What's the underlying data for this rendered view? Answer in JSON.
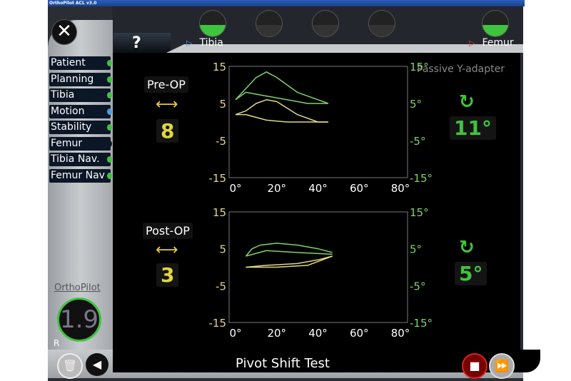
{
  "window": {
    "title": "OrthoPilot ACL v3.0"
  },
  "toolbar": {
    "help_label": "?",
    "segments": [
      {
        "label": "Tibia",
        "marker_color": "#4aa8e0"
      },
      {
        "label": "Femur",
        "marker_color": "#e04a3a"
      }
    ],
    "sensors": [
      {
        "name": "tibia",
        "visible": true
      },
      {
        "name": "s2",
        "visible": false
      },
      {
        "name": "s3",
        "visible": false
      },
      {
        "name": "s4",
        "visible": false
      },
      {
        "name": "femur",
        "visible": true
      }
    ]
  },
  "sidebar": {
    "items": [
      {
        "label": "Patient",
        "status_color": "#3ec33e"
      },
      {
        "label": "Planning",
        "status_color": "#3ec33e"
      },
      {
        "label": "Tibia",
        "status_color": "#3ec33e"
      },
      {
        "label": "Motion",
        "status_color": "#4a9de0"
      },
      {
        "label": "Stability",
        "status_color": "#3ec33e"
      },
      {
        "label": "Femur",
        "status_color": "#0b1626"
      },
      {
        "label": "Tibia Nav.",
        "status_color": "#3ec33e"
      },
      {
        "label": "Femur Nav",
        "status_color": "#3ec33e"
      }
    ],
    "brand": "OrthoPilot",
    "logo_text": "1.9",
    "side": "R"
  },
  "adapter_label": "Passive Y-adapter",
  "pre": {
    "label": "Pre-OP",
    "translation": "8",
    "rotation": "11°"
  },
  "post": {
    "label": "Post-OP",
    "translation": "3",
    "rotation": "5°"
  },
  "footer": {
    "title": "Pivot Shift Test"
  },
  "colors": {
    "translation": "#e2d640",
    "rotation": "#3fc43f",
    "axis_left": "#e2d68a",
    "axis_right": "#7fd36a"
  },
  "chart_data": [
    {
      "type": "line",
      "title": "Pre-OP",
      "xticks": [
        "0°",
        "20°",
        "40°",
        "60°",
        "80°"
      ],
      "yticks_left": [
        "15",
        "5",
        "-5",
        "-15"
      ],
      "yticks_right": [
        "15°",
        "5°",
        "-5°",
        "-15°"
      ],
      "xlim": [
        0,
        80
      ],
      "ylim": [
        -15,
        15
      ],
      "series": [
        {
          "color": "#7fd36a",
          "x": [
            0,
            5,
            10,
            15,
            20,
            30,
            40,
            45
          ],
          "y": [
            6,
            9,
            12,
            13.5,
            12,
            8,
            6,
            5
          ]
        },
        {
          "color": "#7fd36a",
          "x": [
            0,
            5,
            15,
            25,
            35,
            45
          ],
          "y": [
            6,
            8,
            7,
            6,
            5,
            5
          ]
        },
        {
          "color": "#e2d68a",
          "x": [
            0,
            5,
            10,
            15,
            20,
            30,
            40,
            45
          ],
          "y": [
            2,
            3,
            5,
            6,
            5.5,
            2,
            0,
            0
          ]
        },
        {
          "color": "#e2d68a",
          "x": [
            0,
            5,
            15,
            25,
            35,
            45
          ],
          "y": [
            2,
            2,
            0.5,
            0,
            0,
            0
          ]
        }
      ]
    },
    {
      "type": "line",
      "title": "Post-OP",
      "xticks": [
        "0°",
        "20°",
        "40°",
        "60°",
        "80°"
      ],
      "yticks_left": [
        "15",
        "5",
        "-5",
        "-15"
      ],
      "yticks_right": [
        "15°",
        "5°",
        "-5°",
        "-15°"
      ],
      "xlim": [
        0,
        80
      ],
      "ylim": [
        -15,
        15
      ],
      "series": [
        {
          "color": "#7fd36a",
          "x": [
            5,
            8,
            12,
            20,
            30,
            40,
            47
          ],
          "y": [
            3,
            5,
            6,
            6.5,
            6,
            5,
            4
          ]
        },
        {
          "color": "#7fd36a",
          "x": [
            5,
            15,
            30,
            47
          ],
          "y": [
            3,
            4.5,
            4,
            3.5
          ]
        },
        {
          "color": "#e2d68a",
          "x": [
            5,
            15,
            30,
            40,
            47
          ],
          "y": [
            0,
            0.5,
            1,
            2,
            3
          ]
        },
        {
          "color": "#e2d68a",
          "x": [
            5,
            20,
            35,
            47
          ],
          "y": [
            0,
            0,
            0.5,
            3
          ]
        }
      ]
    }
  ]
}
